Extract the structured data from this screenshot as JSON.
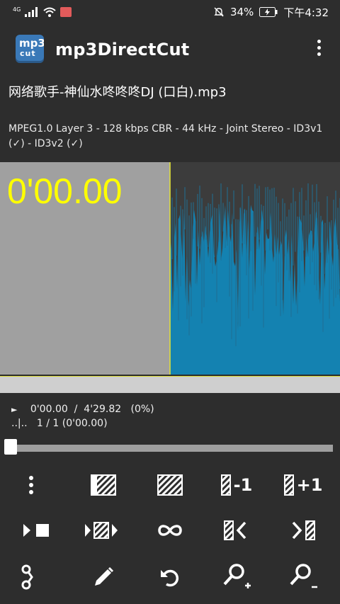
{
  "statusbar": {
    "network": "4G",
    "battery": "34%",
    "time": "下午4:32"
  },
  "app": {
    "logo_top": "mp3",
    "logo_bottom": "cut",
    "title": "mp3DirectCut"
  },
  "file": {
    "name": "网络歌手-神仙水咚咚咚DJ (口白).mp3",
    "info": "MPEG1.0 Layer 3 - 128 kbps CBR - 44 kHz - Joint Stereo - ID3v1 (✓) - ID3v2 (✓)"
  },
  "waveform": {
    "time": "0'00.00",
    "colors": {
      "left_bg": "#a0a0a0",
      "wave": "#1482b1",
      "time_text": "#ffff00"
    }
  },
  "position": {
    "play_icon": "►",
    "current": "0'00.00",
    "separator": "/",
    "total": "4'29.82",
    "percent": "(0%)"
  },
  "cutpoints": {
    "marker": "..|..",
    "value": "1 / 1 (0'00.00)"
  },
  "slider": {
    "position": 0
  },
  "toolbar": {
    "row1": [
      "more-vert-icon",
      "select-left-icon",
      "select-all-icon",
      "selection-minus-icon",
      "selection-plus-icon"
    ],
    "minus1": "-1",
    "plus1": "+1",
    "row2": [
      "play-stop-icon",
      "play-selection-icon",
      "loop-icon",
      "goto-selection-start-icon",
      "goto-selection-end-icon"
    ],
    "row3": [
      "cut-icon",
      "pencil-icon",
      "undo-icon",
      "zoom-in-icon",
      "zoom-out-icon"
    ]
  }
}
